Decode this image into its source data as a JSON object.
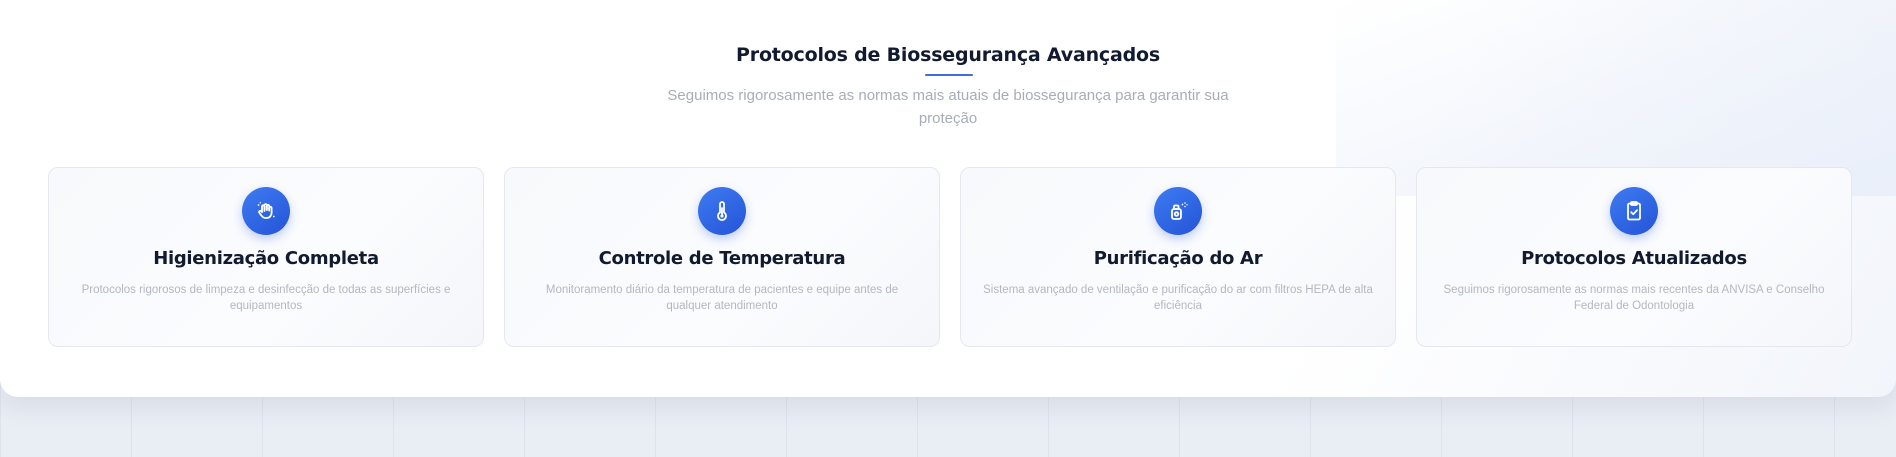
{
  "section": {
    "title": "Protocolos de Biossegurança Avançados",
    "subtitle": "Seguimos rigorosamente as normas mais atuais de biossegurança para garantir sua proteção"
  },
  "cards": [
    {
      "icon": "hand-sanitize-icon",
      "title": "Higienização Completa",
      "description": "Protocolos rigorosos de limpeza e desinfecção de todas as superfícies e equipamentos"
    },
    {
      "icon": "thermometer-icon",
      "title": "Controle de Temperatura",
      "description": "Monitoramento diário da temperatura de pacientes e equipe antes de qualquer atendimento"
    },
    {
      "icon": "air-purifier-icon",
      "title": "Purificação do Ar",
      "description": "Sistema avançado de ventilação e purificação do ar com filtros HEPA de alta eficiência"
    },
    {
      "icon": "clipboard-check-icon",
      "title": "Protocolos Atualizados",
      "description": "Seguimos rigorosamente as normas mais recentes da ANVISA e Conselho Federal de Odontologia"
    }
  ],
  "colors": {
    "accent": "#2f64e6",
    "title": "#111a2e",
    "muted": "#b2b8c2"
  }
}
